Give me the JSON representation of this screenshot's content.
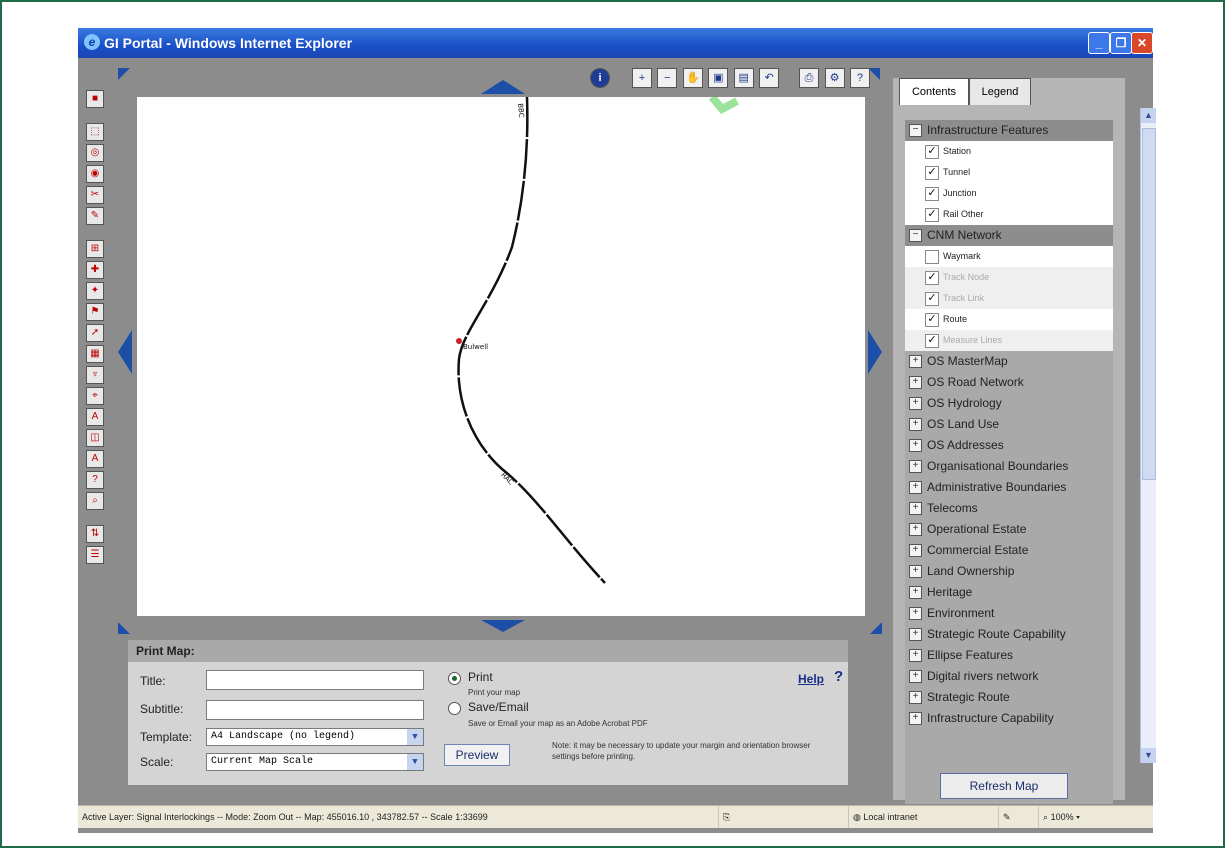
{
  "window": {
    "title": "GI Portal - Windows Internet Explorer"
  },
  "map": {
    "labels": {
      "station": "Bulwell",
      "route_top": "BBC",
      "route_mid": "RAC"
    }
  },
  "print_panel": {
    "header": "Print Map:",
    "title_label": "Title:",
    "subtitle_label": "Subtitle:",
    "template_label": "Template:",
    "template_value": "A4 Landscape (no legend)",
    "scale_label": "Scale:",
    "scale_value": "Current Map Scale",
    "print_option": "Print",
    "print_desc": "Print your map",
    "save_option": "Save/Email",
    "save_desc": "Save or Email your map as an Adobe Acrobat PDF",
    "note": "Note: it may be necessary to update your margin and orientation browser settings before printing.",
    "preview_button": "Preview",
    "help_link": "Help"
  },
  "side_panel": {
    "tabs": [
      "Contents",
      "Legend"
    ],
    "groups": [
      {
        "name": "Infrastructure Features",
        "expanded": true,
        "items": [
          {
            "name": "Station",
            "checked": true,
            "dim": false
          },
          {
            "name": "Tunnel",
            "checked": true,
            "dim": false
          },
          {
            "name": "Junction",
            "checked": true,
            "dim": false
          },
          {
            "name": "Rail Other",
            "checked": true,
            "dim": false
          }
        ]
      },
      {
        "name": "CNM Network",
        "expanded": true,
        "items": [
          {
            "name": "Waymark",
            "checked": false,
            "dim": false
          },
          {
            "name": "Track Node",
            "checked": true,
            "dim": true
          },
          {
            "name": "Track Link",
            "checked": true,
            "dim": true
          },
          {
            "name": "Route",
            "checked": true,
            "dim": false
          },
          {
            "name": "Measure Lines",
            "checked": true,
            "dim": true
          }
        ]
      },
      {
        "name": "OS MasterMap",
        "expanded": false
      },
      {
        "name": "OS Road Network",
        "expanded": false
      },
      {
        "name": "OS Hydrology",
        "expanded": false
      },
      {
        "name": "OS Land Use",
        "expanded": false
      },
      {
        "name": "OS Addresses",
        "expanded": false
      },
      {
        "name": "Organisational Boundaries",
        "expanded": false
      },
      {
        "name": "Administrative Boundaries",
        "expanded": false
      },
      {
        "name": "Telecoms",
        "expanded": false
      },
      {
        "name": "Operational Estate",
        "expanded": false
      },
      {
        "name": "Commercial Estate",
        "expanded": false
      },
      {
        "name": "Land Ownership",
        "expanded": false
      },
      {
        "name": "Heritage",
        "expanded": false
      },
      {
        "name": "Environment",
        "expanded": false
      },
      {
        "name": "Strategic Route Capability",
        "expanded": false
      },
      {
        "name": "Ellipse Features",
        "expanded": false
      },
      {
        "name": "Digital rivers network",
        "expanded": false
      },
      {
        "name": "Strategic Route",
        "expanded": false
      },
      {
        "name": "Infrastructure Capability",
        "expanded": false
      }
    ],
    "refresh_button": "Refresh Map"
  },
  "statusbar": {
    "text": "Active Layer: Signal Interlockings -- Mode: Zoom Out -- Map: 455016.10 , 343782.57 -- Scale 1:33699",
    "zone": "Local intranet",
    "zoom": "100%"
  },
  "colors": {
    "title_bar": "#1a4fc8",
    "route_line": "#111111",
    "station_marker": "#cc2222"
  }
}
